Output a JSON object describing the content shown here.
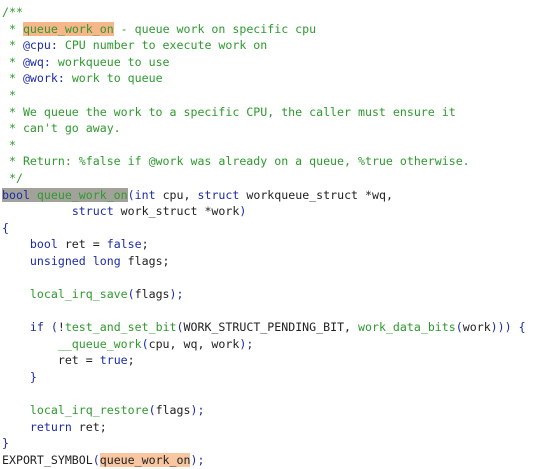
{
  "code": {
    "lines": [
      [
        {
          "t": "/**",
          "c": "cm"
        }
      ],
      [
        {
          "t": " * ",
          "c": "cm"
        },
        {
          "t": "queue_work_on",
          "c": "cm",
          "h": "hl-orange"
        },
        {
          "t": " - queue work on specific cpu",
          "c": "cm"
        }
      ],
      [
        {
          "t": " * ",
          "c": "cm"
        },
        {
          "t": "@cpu:",
          "c": "kw"
        },
        {
          "t": " CPU number to execute work on",
          "c": "cm"
        }
      ],
      [
        {
          "t": " * ",
          "c": "cm"
        },
        {
          "t": "@wq:",
          "c": "kw"
        },
        {
          "t": " workqueue to use",
          "c": "cm"
        }
      ],
      [
        {
          "t": " * ",
          "c": "cm"
        },
        {
          "t": "@work:",
          "c": "kw"
        },
        {
          "t": " work to queue",
          "c": "cm"
        }
      ],
      [
        {
          "t": " *",
          "c": "cm"
        }
      ],
      [
        {
          "t": " * We queue the work to a specific CPU, the caller must ensure it",
          "c": "cm"
        }
      ],
      [
        {
          "t": " * can't go away.",
          "c": "cm"
        }
      ],
      [
        {
          "t": " *",
          "c": "cm"
        }
      ],
      [
        {
          "t": " * Return: %false if @work was already on a queue, %true otherwise.",
          "c": "cm"
        }
      ],
      [
        {
          "t": " */",
          "c": "cm"
        }
      ],
      [
        {
          "t": "bool",
          "c": "kw",
          "h": "hl-gray"
        },
        {
          "t": " queue_work_on",
          "c": "fn",
          "h": "hl-gray"
        },
        {
          "t": "(",
          "c": "pun"
        },
        {
          "t": "int",
          "c": "kw"
        },
        {
          "t": " cpu, ",
          "c": "id"
        },
        {
          "t": "struct",
          "c": "kw"
        },
        {
          "t": " workqueue_struct *wq,",
          "c": "id"
        }
      ],
      [
        {
          "t": "          ",
          "c": "id"
        },
        {
          "t": "struct",
          "c": "kw"
        },
        {
          "t": " work_struct *work",
          "c": "id"
        },
        {
          "t": ")",
          "c": "pun"
        }
      ],
      [
        {
          "t": "{",
          "c": "pun"
        }
      ],
      [
        {
          "t": "    ",
          "c": "id"
        },
        {
          "t": "bool",
          "c": "kw"
        },
        {
          "t": " ret = ",
          "c": "id"
        },
        {
          "t": "false",
          "c": "kw"
        },
        {
          "t": ";",
          "c": "id"
        }
      ],
      [
        {
          "t": "    ",
          "c": "id"
        },
        {
          "t": "unsigned",
          "c": "kw"
        },
        {
          "t": " ",
          "c": "id"
        },
        {
          "t": "long",
          "c": "kw"
        },
        {
          "t": " flags;",
          "c": "id"
        }
      ],
      [
        {
          "t": "",
          "c": "id"
        }
      ],
      [
        {
          "t": "    ",
          "c": "id"
        },
        {
          "t": "local_irq_save",
          "c": "fn"
        },
        {
          "t": "(",
          "c": "pun"
        },
        {
          "t": "flags",
          "c": "id"
        },
        {
          "t": ");",
          "c": "pun"
        }
      ],
      [
        {
          "t": "",
          "c": "id"
        }
      ],
      [
        {
          "t": "    ",
          "c": "id"
        },
        {
          "t": "if",
          "c": "kw"
        },
        {
          "t": " (",
          "c": "pun"
        },
        {
          "t": "!",
          "c": "id"
        },
        {
          "t": "test_and_set_bit",
          "c": "fn"
        },
        {
          "t": "(",
          "c": "pun"
        },
        {
          "t": "WORK_STRUCT_PENDING_BIT, ",
          "c": "id"
        },
        {
          "t": "work_data_bits",
          "c": "fn"
        },
        {
          "t": "(",
          "c": "pun"
        },
        {
          "t": "work",
          "c": "id"
        },
        {
          "t": "))) {",
          "c": "pun"
        }
      ],
      [
        {
          "t": "        ",
          "c": "id"
        },
        {
          "t": "__queue_work",
          "c": "fn"
        },
        {
          "t": "(",
          "c": "pun"
        },
        {
          "t": "cpu, wq, work",
          "c": "id"
        },
        {
          "t": ");",
          "c": "pun"
        }
      ],
      [
        {
          "t": "        ret = ",
          "c": "id"
        },
        {
          "t": "true",
          "c": "kw"
        },
        {
          "t": ";",
          "c": "id"
        }
      ],
      [
        {
          "t": "    ",
          "c": "id"
        },
        {
          "t": "}",
          "c": "pun"
        }
      ],
      [
        {
          "t": "",
          "c": "id"
        }
      ],
      [
        {
          "t": "    ",
          "c": "id"
        },
        {
          "t": "local_irq_restore",
          "c": "fn"
        },
        {
          "t": "(",
          "c": "pun"
        },
        {
          "t": "flags",
          "c": "id"
        },
        {
          "t": ");",
          "c": "pun"
        }
      ],
      [
        {
          "t": "    ",
          "c": "id"
        },
        {
          "t": "return",
          "c": "kw"
        },
        {
          "t": " ret;",
          "c": "id"
        }
      ],
      [
        {
          "t": "}",
          "c": "pun"
        }
      ],
      [
        {
          "t": "EXPORT_SYMBOL",
          "c": "id"
        },
        {
          "t": "(",
          "c": "pun"
        },
        {
          "t": "queue_work_on",
          "c": "id",
          "h": "hl-peach"
        },
        {
          "t": ");",
          "c": "pun"
        }
      ]
    ]
  },
  "colors": {
    "comment": "#2e9a2e",
    "keyword": "#1c2ba8",
    "text": "#1f1f1f",
    "highlight_doc": "#f7b58a",
    "highlight_definition": "#a2a29a",
    "highlight_export": "#f8c6a0"
  }
}
